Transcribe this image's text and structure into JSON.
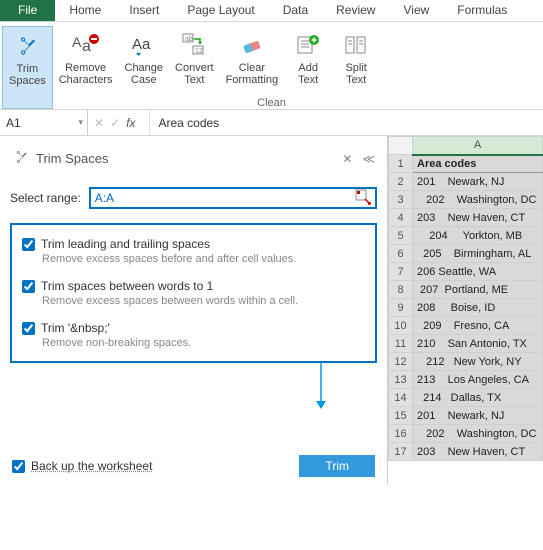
{
  "tabs": {
    "file": "File",
    "items": [
      "Home",
      "Insert",
      "Page Layout",
      "Data",
      "Review",
      "View",
      "Formulas"
    ]
  },
  "ribbon": {
    "group_label": "Clean",
    "buttons": [
      {
        "label": "Trim\nSpaces"
      },
      {
        "label": "Remove\nCharacters"
      },
      {
        "label": "Change\nCase"
      },
      {
        "label": "Convert\nText"
      },
      {
        "label": "Clear\nFormatting"
      },
      {
        "label": "Add\nText"
      },
      {
        "label": "Split\nText"
      }
    ]
  },
  "formula_bar": {
    "namebox": "A1",
    "value": "Area codes"
  },
  "pane": {
    "title": "Trim Spaces",
    "select_label": "Select range:",
    "range_value": "A:A",
    "options": [
      {
        "label": "Trim leading and trailing spaces",
        "desc": "Remove excess spaces before and after cell values.",
        "checked": true
      },
      {
        "label": "Trim spaces between words to 1",
        "desc": "Remove excess spaces between words within a cell.",
        "checked": true
      },
      {
        "label": "Trim '&nbsp;'",
        "desc": "Remove non-breaking spaces.",
        "checked": true
      }
    ],
    "backup_label": "Back up the worksheet",
    "backup_checked": true,
    "trim_button": "Trim"
  },
  "grid": {
    "col_header": "A",
    "header_cell": "Area codes",
    "rows": [
      "201    Newark, NJ",
      "   202    Washington, DC",
      "203    New Haven, CT",
      "    204     Yorkton, MB",
      "  205    Birmingham, AL",
      "206 Seattle, WA",
      " 207  Portland, ME",
      "208     Boise, ID",
      "  209    Fresno, CA",
      "210    San Antonio, TX",
      "   212   New York, NY",
      "213    Los Angeles, CA",
      "  214   Dallas, TX",
      "201    Newark, NJ",
      "   202    Washington, DC",
      "203    New Haven, CT"
    ]
  }
}
